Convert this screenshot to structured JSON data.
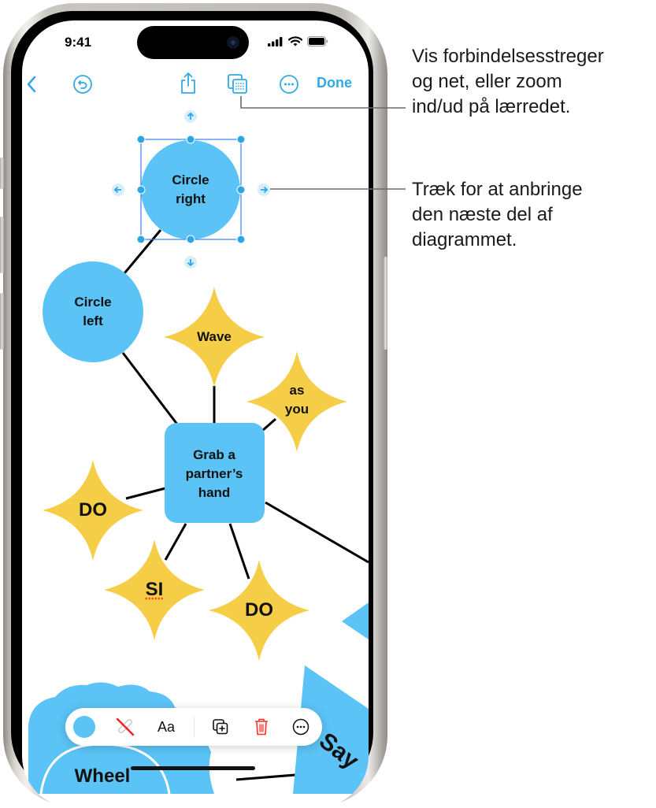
{
  "status_bar": {
    "time": "9:41",
    "icons": [
      "cellular-signal-icon",
      "wifi-icon",
      "battery-icon"
    ]
  },
  "nav_bar": {
    "back_icon": "chevron-left-icon",
    "undo_icon": "undo-icon",
    "share_icon": "share-icon",
    "view_options_icon": "grid-view-icon",
    "more_icon": "ellipsis-circle-icon",
    "done_label": "Done",
    "accent_color": "#32a9e6"
  },
  "diagram": {
    "shape_colors": {
      "blue": "#5bc3f5",
      "yellow": "#f6cd46",
      "connector": "#000000"
    },
    "selected_shape": {
      "label_line1": "Circle",
      "label_line2": "right"
    },
    "shapes": [
      {
        "id": "circle-left",
        "kind": "circle",
        "label_line1": "Circle",
        "label_line2": "left"
      },
      {
        "id": "wave",
        "kind": "star",
        "label_line1": "Wave"
      },
      {
        "id": "as-you",
        "kind": "star",
        "label_line1": "as",
        "label_line2": "you"
      },
      {
        "id": "grab",
        "kind": "rounded-rect",
        "label_line1": "Grab a",
        "label_line2": "partner’s",
        "label_line3": "hand"
      },
      {
        "id": "do-left",
        "kind": "star",
        "label_line1": "DO"
      },
      {
        "id": "si",
        "kind": "star",
        "label_line1": "SI"
      },
      {
        "id": "do-bottom",
        "kind": "star",
        "label_line1": "DO"
      },
      {
        "id": "wheel",
        "kind": "cloud",
        "label_line1": "Wheel"
      },
      {
        "id": "say",
        "kind": "triangle",
        "label_line1": "Say"
      }
    ]
  },
  "shape_toolbar": {
    "fill_color": "#5bc3f5",
    "items": [
      {
        "name": "fill-color",
        "icon": "color-swatch-icon"
      },
      {
        "name": "stroke",
        "icon": "no-stroke-icon"
      },
      {
        "name": "text-style",
        "label": "Aa"
      },
      {
        "name": "duplicate",
        "icon": "duplicate-icon"
      },
      {
        "name": "delete",
        "icon": "trash-icon",
        "color": "#ff2d2d"
      },
      {
        "name": "more",
        "icon": "ellipsis-circle-icon"
      }
    ]
  },
  "callouts": [
    {
      "lines": [
        "Vis forbindelsesstreger",
        "og net, eller zoom",
        "ind/ud på lærredet."
      ]
    },
    {
      "lines": [
        "Træk for at anbringe",
        "den næste del af",
        "diagrammet."
      ]
    }
  ]
}
